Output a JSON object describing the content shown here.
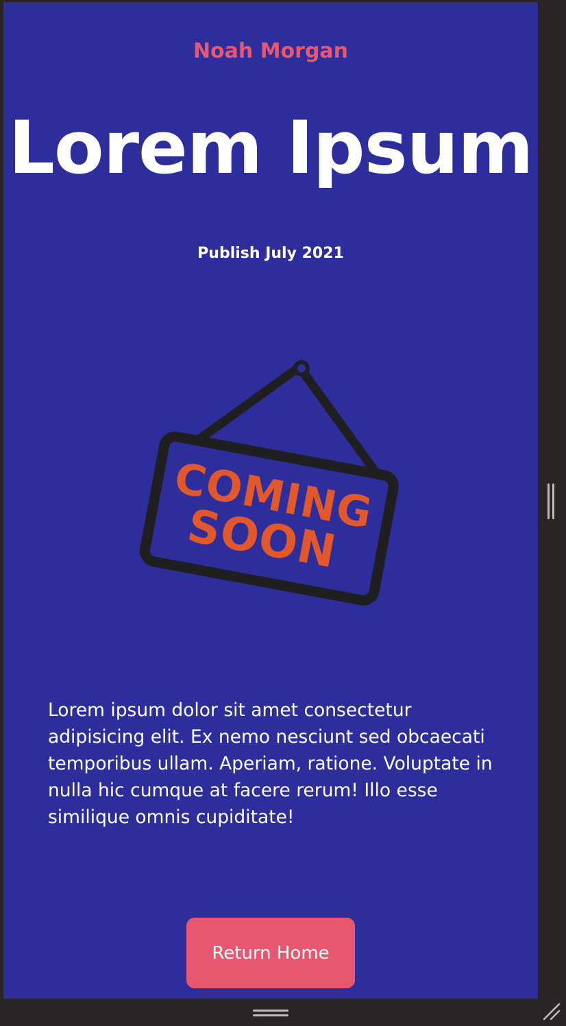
{
  "header": {
    "author": "Noah Morgan",
    "title": "Lorem Ipsum",
    "publish": "Publish July 2021"
  },
  "illustration": {
    "sign_line1": "COMING",
    "sign_line2": "SOON",
    "icon": "hanging-sign-icon"
  },
  "content": {
    "paragraph": "Lorem ipsum dolor sit amet consectetur adipisicing elit. Ex nemo nesciunt sed obcaecati temporibus ullam. Aperiam, ratione. Voluptate in nulla hic cumque at facere rerum! Illo esse similique omnis cupiditate!"
  },
  "actions": {
    "return_home_label": "Return Home"
  },
  "colors": {
    "background": "#2d2d9b",
    "accent": "#e8576f",
    "sign_text": "#e0582b",
    "sign_outline": "#1f1f22",
    "frame": "#2b2424"
  }
}
